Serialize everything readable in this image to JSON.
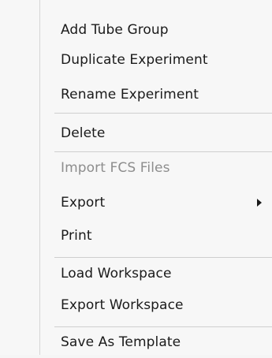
{
  "menu": {
    "items": [
      {
        "label": "Add Tube Group",
        "enabled": true
      },
      {
        "label": "Duplicate Experiment",
        "enabled": true
      },
      {
        "label": "Rename Experiment",
        "enabled": true
      },
      {
        "label": "Delete",
        "enabled": true
      },
      {
        "label": "Import FCS Files",
        "enabled": false
      },
      {
        "label": "Export",
        "enabled": true,
        "has_submenu": true,
        "submenu_icon": "chevron-right-icon"
      },
      {
        "label": "Print",
        "enabled": true
      },
      {
        "label": "Load Workspace",
        "enabled": true
      },
      {
        "label": "Export Workspace",
        "enabled": true
      },
      {
        "label": "Save As Template",
        "enabled": true
      }
    ]
  },
  "colors": {
    "background": "#f7f7f7",
    "text": "#1a1a1a",
    "disabled_text": "#8d8d8d",
    "separator": "#cfcfcf"
  }
}
